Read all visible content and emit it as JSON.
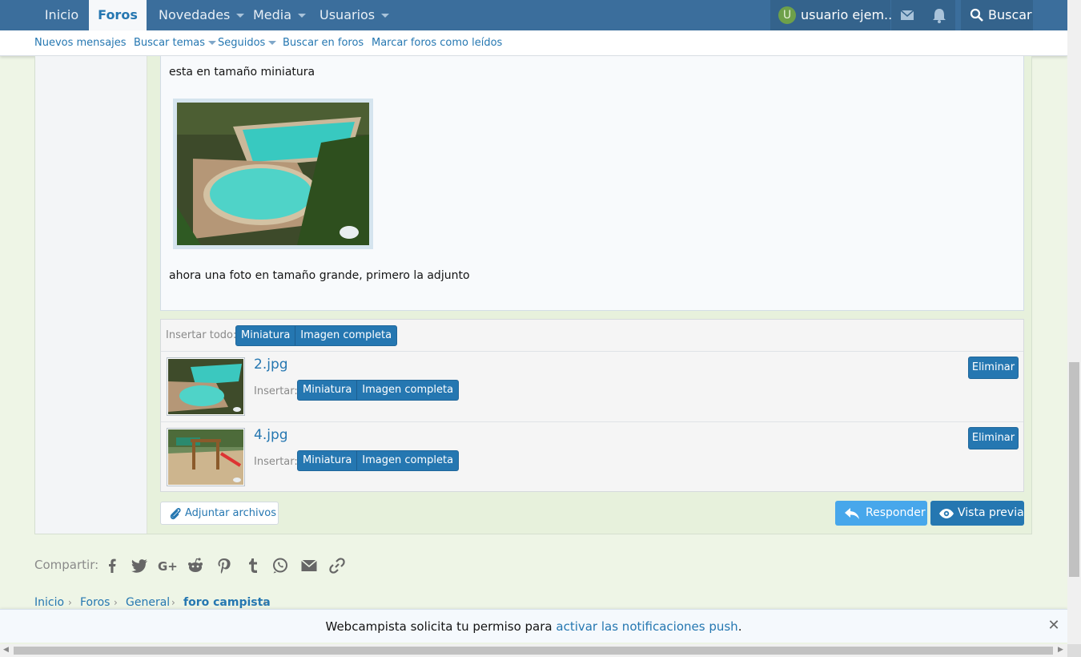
{
  "topnav": {
    "tabs": [
      {
        "label": "Inicio"
      },
      {
        "label": "Foros"
      },
      {
        "label": "Novedades"
      },
      {
        "label": "Media"
      },
      {
        "label": "Usuarios"
      }
    ],
    "user": {
      "avatar_letter": "U",
      "name": "usuario ejem..."
    },
    "search_label": "Buscar"
  },
  "subnav": {
    "items": [
      {
        "label": "Nuevos mensajes"
      },
      {
        "label": "Buscar temas"
      },
      {
        "label": "Seguidos"
      },
      {
        "label": "Buscar en foros"
      },
      {
        "label": "Marcar foros como leídos"
      }
    ]
  },
  "editor": {
    "line1": "esta en tamaño miniatura",
    "line2": "ahora una foto en tamaño grande, primero la adjunto"
  },
  "attachments": {
    "insert_all_label": "Insertar todo:",
    "insert_label": "Insertar:",
    "thumb_label": "Miniatura",
    "full_label": "Imagen completa",
    "delete_label": "Eliminar",
    "files": [
      {
        "name": "2.jpg"
      },
      {
        "name": "4.jpg"
      }
    ]
  },
  "actions": {
    "attach_files": "Adjuntar archivos",
    "reply": "Responder",
    "preview": "Vista previa"
  },
  "share": {
    "label": "Compartir:"
  },
  "breadcrumb": [
    "Inicio",
    "Foros",
    "General",
    "foro campista"
  ],
  "notification": {
    "text_before": "Webcampista solicita tu permiso para ",
    "link": "activar las notificaciones push",
    "text_after": "."
  },
  "colors": {
    "nav": "#3b6e9c",
    "accent": "#2577b1",
    "page_bg": "#eef5e6",
    "reply": "#47a7eb"
  }
}
